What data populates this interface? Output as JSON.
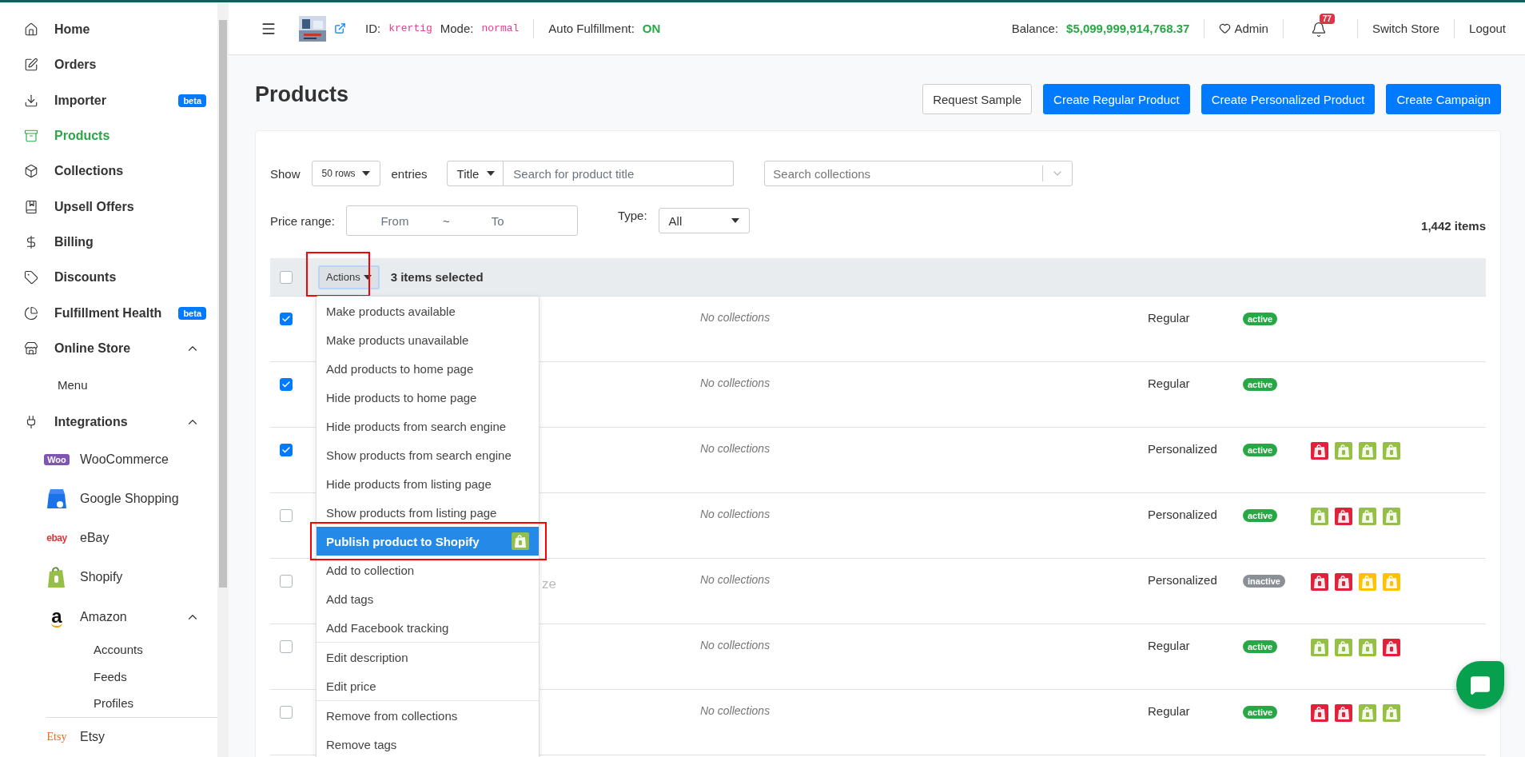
{
  "sidebar": {
    "items": [
      {
        "label": "Home",
        "selected": false
      },
      {
        "label": "Orders",
        "selected": false
      },
      {
        "label": "Importer",
        "selected": false,
        "badge": "beta"
      },
      {
        "label": "Products",
        "selected": true
      },
      {
        "label": "Collections",
        "selected": false
      },
      {
        "label": "Upsell Offers",
        "selected": false
      },
      {
        "label": "Billing",
        "selected": false
      },
      {
        "label": "Discounts",
        "selected": false
      },
      {
        "label": "Fulfillment Health",
        "selected": false,
        "badge": "beta"
      },
      {
        "label": "Online Store",
        "selected": false,
        "expanded": true,
        "children": [
          {
            "label": "Menu"
          }
        ]
      },
      {
        "label": "Integrations",
        "selected": false,
        "expanded": true,
        "children": [
          {
            "label": "WooCommerce",
            "logo_text": "Woo"
          },
          {
            "label": "Google Shopping"
          },
          {
            "label": "eBay",
            "logo_text": "ebay"
          },
          {
            "label": "Shopify"
          },
          {
            "label": "Amazon",
            "logo_text": "a",
            "expanded": true,
            "children": [
              {
                "label": "Accounts"
              },
              {
                "label": "Feeds"
              },
              {
                "label": "Profiles"
              }
            ]
          },
          {
            "label": "Etsy",
            "logo_text": "Etsy"
          }
        ]
      }
    ]
  },
  "topbar": {
    "id_label": "ID:",
    "id_value": "krertig",
    "mode_label": "Mode:",
    "mode_value": "normal",
    "auto_label": "Auto Fulfillment:",
    "auto_value": "ON",
    "balance_label": "Balance:",
    "balance_value": "$5,099,999,914,768.37",
    "user": "Admin",
    "notifications": "77",
    "switch_store": "Switch Store",
    "logout": "Logout"
  },
  "page": {
    "title": "Products",
    "buttons": [
      {
        "label": "Request Sample",
        "kind": "outline"
      },
      {
        "label": "Create Regular Product",
        "kind": "primary"
      },
      {
        "label": "Create Personalized Product",
        "kind": "primary"
      },
      {
        "label": "Create Campaign",
        "kind": "primary"
      }
    ]
  },
  "filters": {
    "show_label": "Show",
    "rows_value": "50 rows",
    "entries_label": "entries",
    "search_field": "Title",
    "search_placeholder": "Search for product title",
    "collections_placeholder": "Search collections",
    "price_label": "Price range:",
    "from_placeholder": "From",
    "range_sep": "~",
    "to_placeholder": "To",
    "type_label": "Type:",
    "type_value": "All",
    "count": "1,442 items"
  },
  "table": {
    "header": {
      "checked": false,
      "actions": "Actions",
      "annotated": true,
      "selected_text": "3 items selected"
    },
    "rows": [
      {
        "checked": true,
        "collections": "No collections",
        "type": "Regular",
        "status": "active",
        "status_active": true,
        "stores": []
      },
      {
        "checked": true,
        "collections": "No collections",
        "type": "Regular",
        "status": "active",
        "status_active": true,
        "stores": []
      },
      {
        "checked": true,
        "collections": "No collections",
        "type": "Personalized",
        "status": "active",
        "status_active": true,
        "stores": [
          {
            "color": "#e0213a"
          },
          {
            "color": "#95bf47"
          },
          {
            "color": "#95bf47"
          },
          {
            "color": "#95bf47"
          }
        ]
      },
      {
        "checked": false,
        "collections": "No collections",
        "type": "Personalized",
        "status": "active",
        "status_active": true,
        "stores": [
          {
            "color": "#95bf47"
          },
          {
            "color": "#e0213a"
          },
          {
            "color": "#95bf47"
          },
          {
            "color": "#95bf47"
          }
        ]
      },
      {
        "checked": false,
        "title": "ze",
        "collections": "No collections",
        "type": "Personalized",
        "status": "inactive",
        "status_active": false,
        "stores": [
          {
            "color": "#e0213a"
          },
          {
            "color": "#e0213a"
          },
          {
            "color": "#ffc107"
          },
          {
            "color": "#ffc107"
          }
        ]
      },
      {
        "checked": false,
        "collections": "No collections",
        "type": "Regular",
        "status": "active",
        "status_active": true,
        "stores": [
          {
            "color": "#95bf47"
          },
          {
            "color": "#95bf47"
          },
          {
            "color": "#95bf47"
          },
          {
            "color": "#e0213a"
          }
        ]
      },
      {
        "checked": false,
        "collections": "No collections",
        "type": "Regular",
        "status": "active",
        "status_active": true,
        "stores": [
          {
            "color": "#e0213a"
          },
          {
            "color": "#e0213a"
          },
          {
            "color": "#95bf47"
          },
          {
            "color": "#95bf47"
          }
        ]
      }
    ]
  },
  "actions_menu": {
    "groups": [
      [
        {
          "label": "Make products available",
          "selected": false,
          "kind": "action"
        },
        {
          "label": "Make products unavailable",
          "selected": false,
          "kind": "action"
        },
        {
          "label": "Add products to home page",
          "selected": false,
          "kind": "action"
        },
        {
          "label": "Hide products to home page",
          "selected": false,
          "kind": "action"
        },
        {
          "label": "Hide products from search engine",
          "selected": false,
          "kind": "action"
        },
        {
          "label": "Show products from search engine",
          "selected": false,
          "kind": "action"
        },
        {
          "label": "Hide products from listing page",
          "selected": false,
          "kind": "action"
        },
        {
          "label": "Show products from listing page",
          "selected": false,
          "kind": "action"
        },
        {
          "label": "Publish product to Shopify",
          "selected": true,
          "annotated": true,
          "kind": "store-action"
        },
        {
          "label": "Add to collection",
          "selected": false,
          "kind": "action"
        },
        {
          "label": "Add tags",
          "selected": false,
          "kind": "action"
        },
        {
          "label": "Add Facebook tracking",
          "selected": false,
          "kind": "action"
        }
      ],
      [
        {
          "label": "Edit description",
          "selected": false,
          "kind": "action"
        },
        {
          "label": "Edit price",
          "selected": false,
          "kind": "action"
        }
      ],
      [
        {
          "label": "Remove from collections",
          "selected": false,
          "kind": "action"
        },
        {
          "label": "Remove tags",
          "selected": false,
          "kind": "action"
        }
      ]
    ]
  }
}
